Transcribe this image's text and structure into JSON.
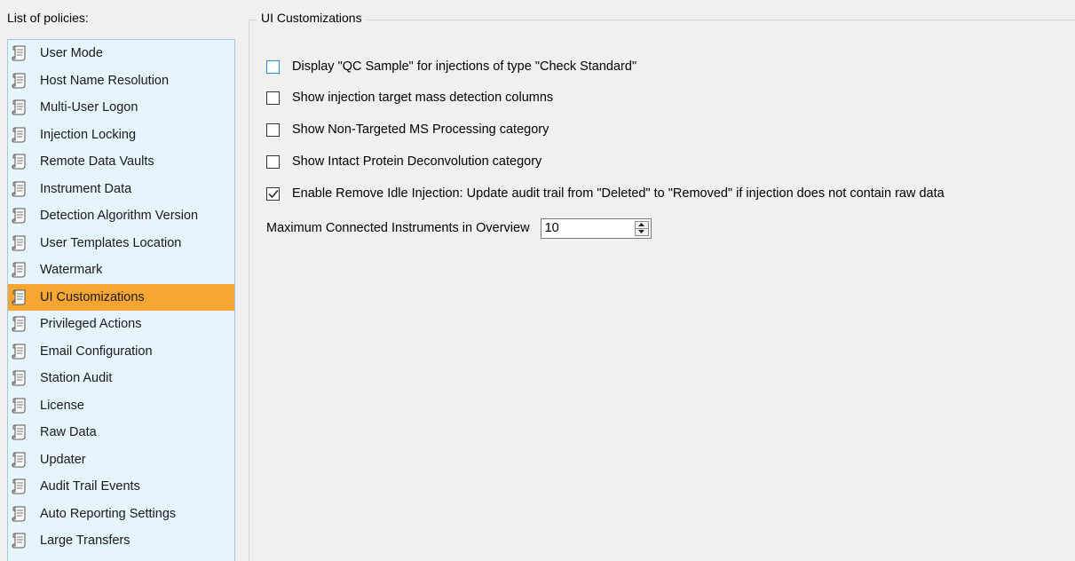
{
  "left_panel": {
    "label": "List of policies:",
    "selected_index": 9,
    "items": [
      {
        "label": "User Mode"
      },
      {
        "label": "Host Name Resolution"
      },
      {
        "label": "Multi-User Logon"
      },
      {
        "label": "Injection Locking"
      },
      {
        "label": "Remote Data Vaults"
      },
      {
        "label": "Instrument Data"
      },
      {
        "label": "Detection Algorithm Version"
      },
      {
        "label": "User Templates Location"
      },
      {
        "label": "Watermark"
      },
      {
        "label": "UI Customizations"
      },
      {
        "label": "Privileged Actions"
      },
      {
        "label": "Email Configuration"
      },
      {
        "label": "Station Audit"
      },
      {
        "label": "License"
      },
      {
        "label": "Raw Data"
      },
      {
        "label": "Updater"
      },
      {
        "label": "Audit Trail Events"
      },
      {
        "label": "Auto Reporting Settings"
      },
      {
        "label": "Large Transfers"
      }
    ],
    "item_icon": "policy-scroll-icon"
  },
  "group": {
    "title": "UI Customizations",
    "options": [
      {
        "label": "Display \"QC Sample\" for injections of type \"Check Standard\"",
        "checked": false,
        "focused": true
      },
      {
        "label": "Show injection target mass detection columns",
        "checked": false,
        "focused": false
      },
      {
        "label": "Show Non-Targeted MS Processing category",
        "checked": false,
        "focused": false
      },
      {
        "label": "Show Intact Protein Deconvolution category",
        "checked": false,
        "focused": false
      },
      {
        "label": "Enable Remove Idle Injection: Update audit trail from \"Deleted\" to \"Removed\" if injection does not contain raw data",
        "checked": true,
        "focused": false
      }
    ],
    "max_instruments": {
      "label": "Maximum Connected Instruments in Overview",
      "value": "10"
    }
  },
  "colors": {
    "selected_bg": "#f8a632",
    "list_bg": "#e6f4fc",
    "window_bg": "#f0f0f0",
    "focus_border": "#2e8bd8"
  }
}
